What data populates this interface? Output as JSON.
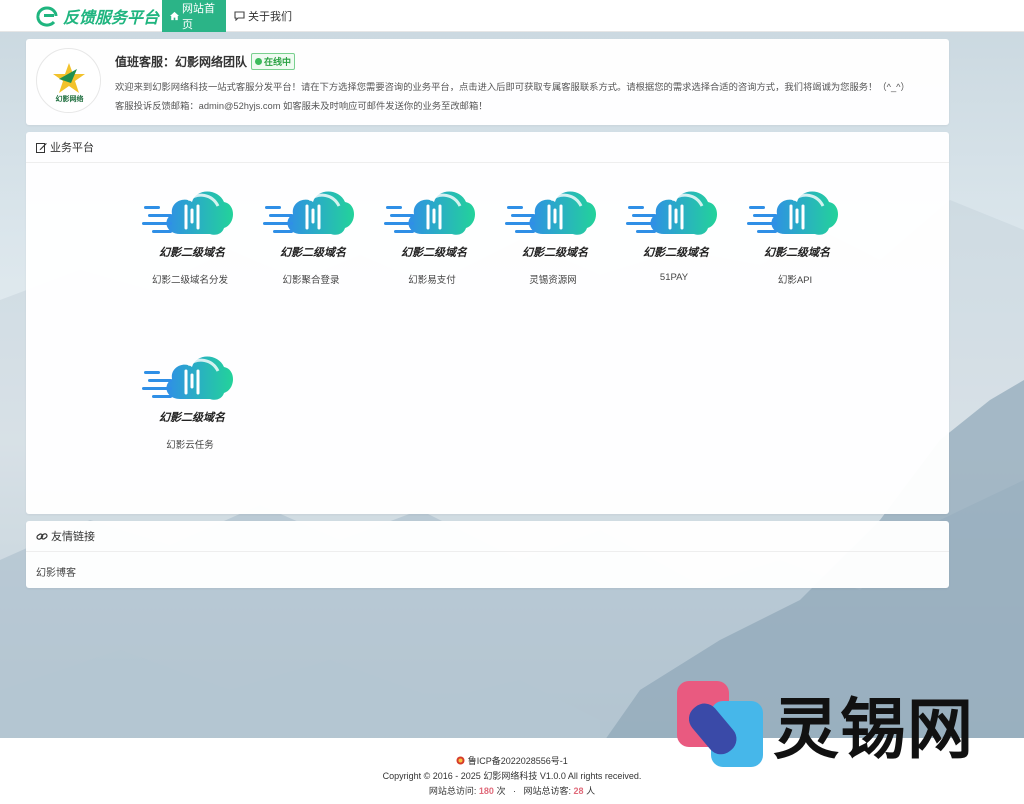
{
  "nav": {
    "brand": "反馈服务平台",
    "home_label": "网站首页",
    "about_label": "关于我们"
  },
  "profile": {
    "name": "值班客服：幻影网络团队",
    "status": "在线中",
    "description": "欢迎来到幻影网络科技一站式客服分发平台！请在下方选择您需要咨询的业务平台，点击进入后即可获取专属客服联系方式。请根据您的需求选择合适的咨询方式，我们将竭诚为您服务！（^_^）",
    "email_line": "客服投诉反馈邮箱：admin@52hyjs.com 如客服未及时响应可邮件发送你的业务至改邮箱！",
    "avatar_text": "幻影网络"
  },
  "platform": {
    "title": "业务平台",
    "tile_logo_text": "幻影二级域名",
    "items": [
      {
        "label": "幻影二级域名分发"
      },
      {
        "label": "幻影聚合登录"
      },
      {
        "label": "幻影易支付"
      },
      {
        "label": "灵锡资源网"
      },
      {
        "label": "51PAY"
      },
      {
        "label": "幻影API"
      },
      {
        "label": "幻影云任务"
      }
    ]
  },
  "links": {
    "title": "友情链接",
    "items": [
      {
        "label": "幻影博客"
      }
    ]
  },
  "footer": {
    "icp": "鲁ICP备2022028556号-1",
    "copyright": "Copyright © 2016 - 2025 幻影网络科技 V1.0.0 All rights received.",
    "visits_label": "网站总访问:",
    "visits_value": "180",
    "visits_unit": "次",
    "separator": "·",
    "visitors_label": "网站总访客:",
    "visitors_value": "28",
    "visitors_unit": "人"
  },
  "watermark": {
    "text": "灵锡网"
  },
  "colors": {
    "accent": "#2bb487",
    "status": "#3dbb5c",
    "count": "#e06a7a"
  }
}
